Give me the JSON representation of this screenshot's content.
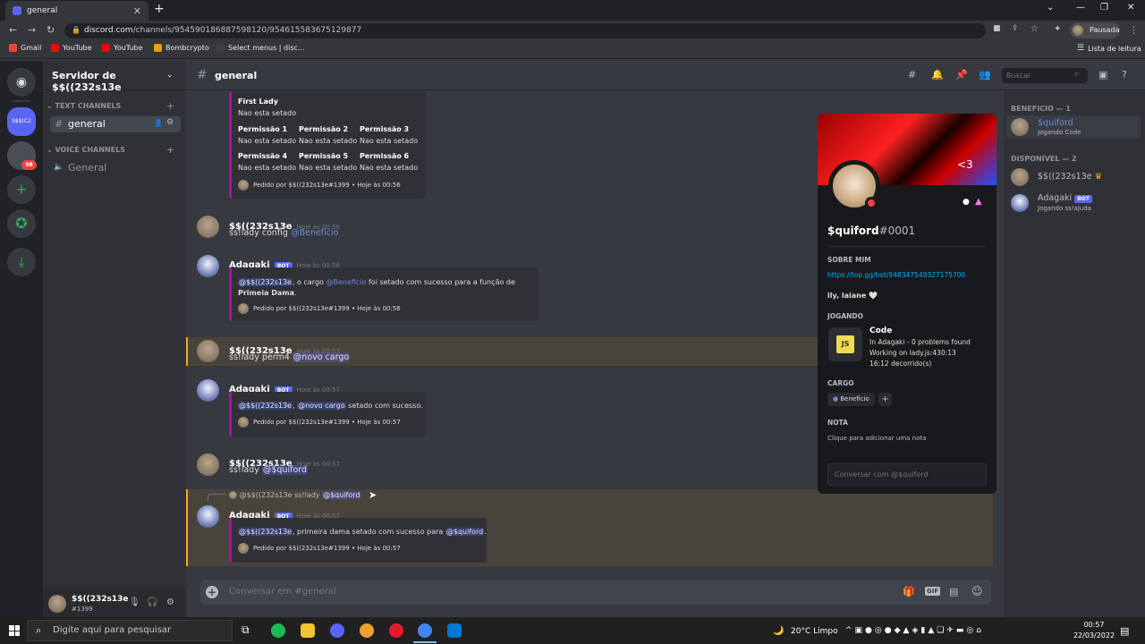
{
  "browser": {
    "tab_title": "general",
    "url_host": "discord.com",
    "url_path": "/channels/954590186887598120/954615583675129877",
    "profile_label": "Pausada",
    "reading_list": "Lista de leitura",
    "bookmarks": [
      "Gmail",
      "YouTube",
      "YouTube",
      "Bombcrypto",
      "Select menus | disc..."
    ]
  },
  "server": {
    "name": "Servidor de $$((232s13e",
    "text_category": "TEXT CHANNELS",
    "text_channel": "general",
    "voice_category": "VOICE CHANNELS",
    "voice_channel": "General",
    "guild_abbrev": "S$$(C2",
    "badge": "98"
  },
  "user": {
    "name": "$$((232s13e",
    "tag": "#1399"
  },
  "header": {
    "channel": "general",
    "search_placeholder": "Buscar"
  },
  "embed1": {
    "title": "First Lady",
    "value": "Nao esta setado",
    "perms": [
      {
        "n": "Permissão 1",
        "v": "Nao esta setado"
      },
      {
        "n": "Permissão 2",
        "v": "Nao esta setado"
      },
      {
        "n": "Permissão 3",
        "v": "Nao esta setado"
      },
      {
        "n": "Permissão 4",
        "v": "Nao esta setado"
      },
      {
        "n": "Permissão 5",
        "v": "Nao esta setado"
      },
      {
        "n": "Permissão 6",
        "v": "Nao esta setado"
      }
    ],
    "footer": "Pedido por $$((232s13e#1399 • Hoje às 00:56"
  },
  "messages": [
    {
      "author": "$$((232s13e",
      "time": "Hoje às 00:56",
      "text": "ss!lady config",
      "mention": "@Benefício"
    },
    {
      "author": "Adagaki",
      "bot": "BOT",
      "time": "Hoje às 00:56",
      "e_mention": "@$$((232s13e",
      "e_a": ", o cargo",
      "e_role": "@Beneficio",
      "e_b": "foi setado com sucesso para a função de",
      "e_bold": "Primeia Dama",
      "e_end": ".",
      "footer": "Pedido por $$((232s13e#1399 • Hoje às 00:56"
    },
    {
      "author": "$$((232s13e",
      "time": "Hoje às 00:57",
      "text": "ss!lady perm4",
      "mention": "@novo cargo"
    },
    {
      "author": "Adagaki",
      "bot": "BOT",
      "time": "Hoje às 00:57",
      "e_mention": "@$$((232s13e",
      "e_sep": ",",
      "e_role": "@novo cargo",
      "e_b": "setado com sucesso.",
      "footer": "Pedido por $$((232s13e#1399 • Hoje às 00:57"
    },
    {
      "author": "$$((232s13e",
      "time": "Hoje às 00:57",
      "text": "ss!lady",
      "mention": "@$quiford"
    },
    {
      "reply_user": "@$$((232s13e",
      "reply_text": "ss!lady",
      "reply_mention": "@$quiford",
      "author": "Adagaki",
      "bot": "BOT",
      "time": "Hoje às 00:57",
      "e_mention": "@$$((232s13e",
      "e_b": ", primeira dama setado com sucesso para",
      "e_role": "@$quiford",
      "e_end": ".",
      "footer": "Pedido por $$((232s13e#1399 • Hoje às 00:57"
    }
  ],
  "input_placeholder": "Conversar em #general",
  "popup": {
    "name": "$quiford",
    "discrim": "#0001",
    "banner_text": "<3",
    "about_title": "SOBRE MIM",
    "about_link": "https://top.gg/bot/948347549327175700",
    "about_text": "ily, laiane 🤍",
    "playing_title": "JOGANDO",
    "app": "Code",
    "d1": "In Adagaki - 0 problems found",
    "d2": "Working on lady.js:430:13",
    "d3": "16:12 decorrido(s)",
    "cargo_title": "CARGO",
    "role": "Beneficio",
    "note_title": "NOTA",
    "note": "Clique para adicionar uma nota",
    "msg_placeholder": "Conversar com @$quiford"
  },
  "members": {
    "cat1": "BENEFICIO — 1",
    "m1": "$quiford",
    "m1s": "Jogando Code",
    "cat2": "DISPONÍVEL — 2",
    "m2": "$$((232s13e",
    "m3": "Adagaki",
    "m3bot": "BOT",
    "m3s": "Jogando ss!ajuda"
  },
  "taskbar": {
    "search": "Digite aqui para pesquisar",
    "weather": "20°C Limpo",
    "time": "00:57",
    "date": "22/03/2022"
  }
}
